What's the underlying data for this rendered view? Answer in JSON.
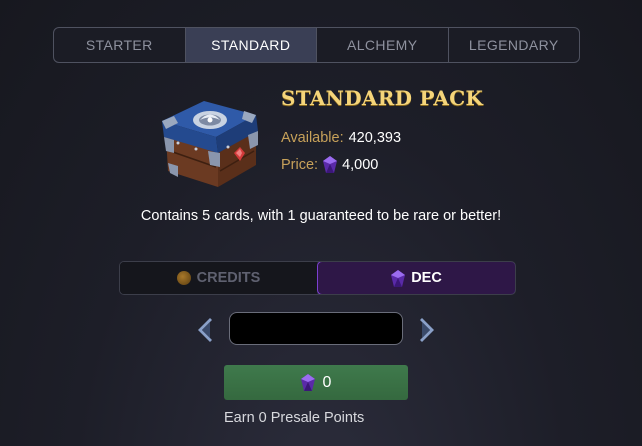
{
  "tabs": [
    {
      "label": "STARTER",
      "active": false
    },
    {
      "label": "STANDARD",
      "active": true
    },
    {
      "label": "ALCHEMY",
      "active": false
    },
    {
      "label": "LEGENDARY",
      "active": false
    }
  ],
  "pack": {
    "title": "STANDARD PACK",
    "available_label": "Available:",
    "available_value": "420,393",
    "price_label": "Price:",
    "price_value": "4,000",
    "price_icon": "dec-gem-icon",
    "description": "Contains 5 cards, with 1 guaranteed to be rare or better!"
  },
  "currency": {
    "credits_label": "CREDITS",
    "dec_label": "DEC",
    "selected": "DEC"
  },
  "quantity": {
    "value": ""
  },
  "buy": {
    "amount": "0",
    "icon": "dec-gem-icon"
  },
  "presale": {
    "text": "Earn 0 Presale Points"
  },
  "colors": {
    "accent_gold": "#f5d57a",
    "label_gold": "#c7a15a",
    "dec_purple": "#7b3fd0",
    "buy_green": "#3f7a4c",
    "active_tab": "#3a3f55"
  }
}
